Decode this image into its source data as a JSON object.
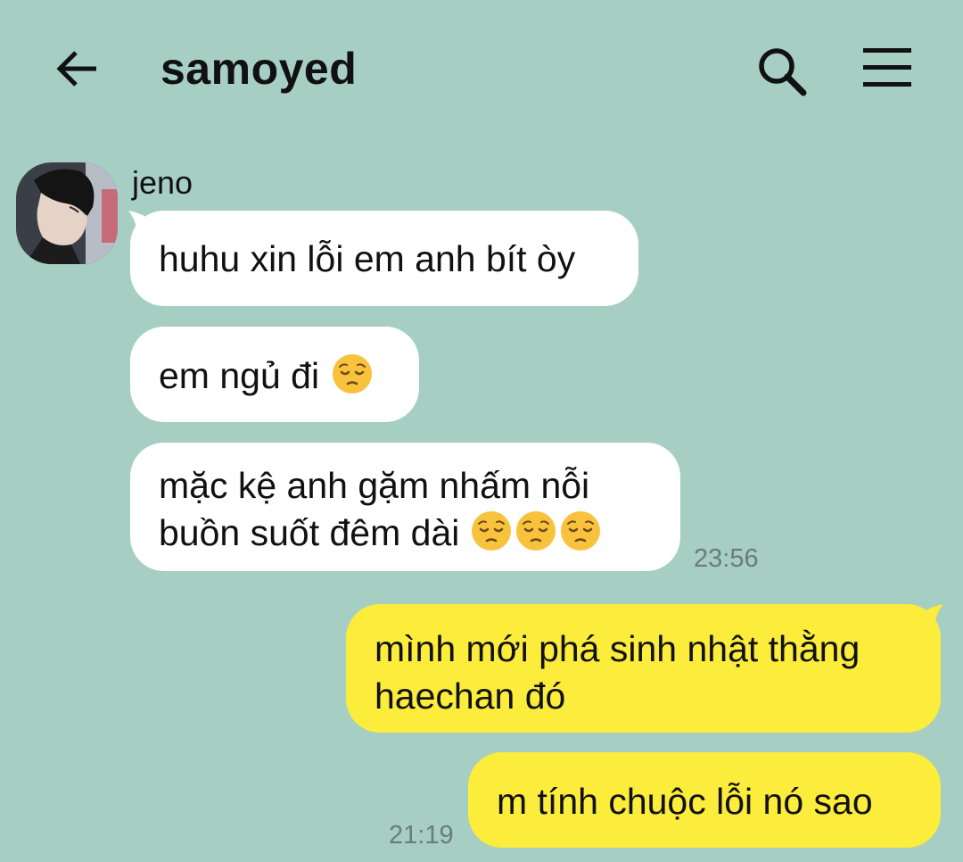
{
  "header": {
    "title": "samoyed",
    "back_icon": "arrow-left-icon",
    "search_icon": "search-icon",
    "menu_icon": "hamburger-menu-icon"
  },
  "conversation": {
    "sender_name": "jeno",
    "incoming": [
      {
        "text": "huhu xin lỗi em anh bít òy"
      },
      {
        "text": "em ngủ đi",
        "emoji": "pensive-face-icon"
      },
      {
        "line1": "mặc kệ anh gặm nhấm nỗi",
        "line2": "buồn suốt đêm dài",
        "emoji": "pensive-face-icon"
      }
    ],
    "incoming_time": "23:56",
    "outgoing": [
      {
        "line1": "mình mới phá sinh nhật thằng",
        "line2": "haechan đó"
      },
      {
        "text": "m tính chuộc lỗi nó sao"
      }
    ],
    "outgoing_time": "21:19"
  },
  "colors": {
    "background": "#a6cec2",
    "incoming_bubble": "#ffffff",
    "outgoing_bubble": "#fcec3c"
  }
}
